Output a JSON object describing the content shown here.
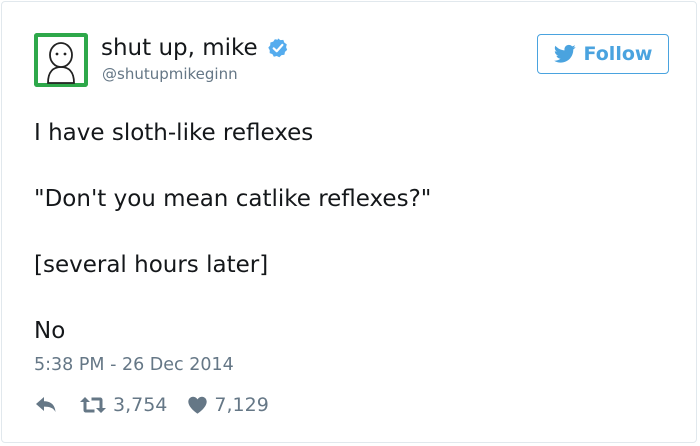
{
  "author": {
    "display_name": "shut up, mike",
    "handle": "@shutupmikeginn",
    "verified_icon": "verified-badge-icon",
    "avatar_icon": "cartoon-face-avatar"
  },
  "follow_button": {
    "label": "Follow",
    "icon": "twitter-bird-icon"
  },
  "tweet": {
    "lines": [
      "I have sloth-like reflexes",
      "\"Don't you mean catlike reflexes?\"",
      "[several hours later]",
      "No"
    ],
    "timestamp": "5:38 PM - 26 Dec 2014"
  },
  "actions": {
    "reply_icon": "reply-icon",
    "retweet_icon": "retweet-icon",
    "retweet_count": "3,754",
    "like_icon": "heart-icon",
    "like_count": "7,129"
  },
  "colors": {
    "accent": "#4aa3df",
    "verified": "#55acee",
    "muted": "#657786",
    "text": "#14171a",
    "avatar_bg": "#2ea84a",
    "border": "#e1e8ed"
  }
}
